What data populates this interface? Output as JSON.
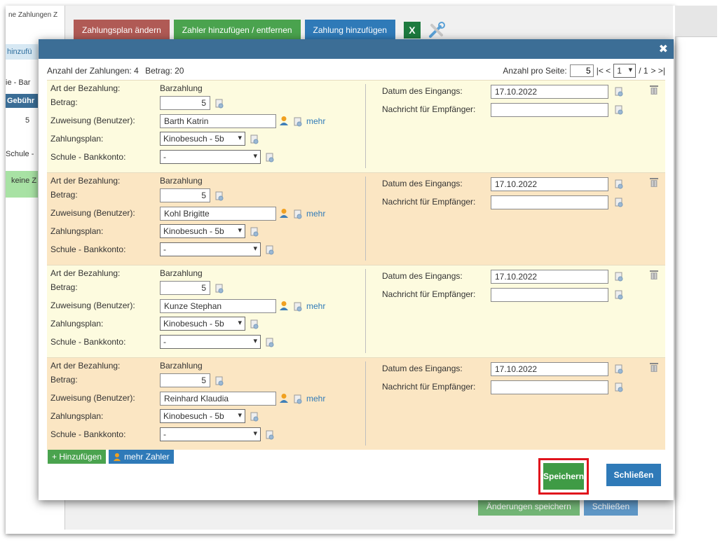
{
  "background": {
    "breadcrumb": "ne Zahlungen   Z",
    "tabs": [
      "Zahlungsplan ändern",
      "Zahler hinzufügen / entfernen",
      "Zahlung hinzufügen"
    ],
    "side_add_button": "hinzufü",
    "side_label_1": "ie - Bar",
    "side_header": "Gebühr",
    "side_value": "5",
    "side_label_2": "Schule -",
    "side_status": "keine Z",
    "bottom_buttons": [
      "Änderungen speichern",
      "Schließen"
    ],
    "colors": {
      "tab_red": "#b05a55",
      "tab_green": "#4aa34e",
      "tab_blue": "#2f7ab8"
    }
  },
  "modal": {
    "close_symbol": "✖",
    "summary": {
      "count_label": "Anzahl der Zahlungen: 4",
      "amount_label": "Betrag: 20"
    },
    "pager": {
      "per_page_label": "Anzahl pro Seite:",
      "per_page": "5",
      "first_prev": "|< <",
      "page": "1",
      "total": "/ 1",
      "next_last": "> >|"
    },
    "labels": {
      "art": "Art der Bezahlung:",
      "betrag": "Betrag:",
      "zuweisung": "Zuweisung (Benutzer):",
      "zahlungsplan": "Zahlungsplan:",
      "bankkonto": "Schule - Bankkonto:",
      "datum": "Datum des Eingangs:",
      "nachricht": "Nachricht für Empfänger:",
      "mehr": "mehr"
    },
    "entries": [
      {
        "art": "Barzahlung",
        "betrag": "5",
        "benutzer": "Barth Katrin",
        "plan": "Kinobesuch - 5b",
        "konto": "-",
        "datum": "17.10.2022",
        "nachricht": ""
      },
      {
        "art": "Barzahlung",
        "betrag": "5",
        "benutzer": "Kohl Brigitte",
        "plan": "Kinobesuch - 5b",
        "konto": "-",
        "datum": "17.10.2022",
        "nachricht": ""
      },
      {
        "art": "Barzahlung",
        "betrag": "5",
        "benutzer": "Kunze Stephan",
        "plan": "Kinobesuch - 5b",
        "konto": "-",
        "datum": "17.10.2022",
        "nachricht": ""
      },
      {
        "art": "Barzahlung",
        "betrag": "5",
        "benutzer": "Reinhard Klaudia",
        "plan": "Kinobesuch - 5b",
        "konto": "-",
        "datum": "17.10.2022",
        "nachricht": ""
      }
    ],
    "add_button": "+ Hinzufügen",
    "more_payers_button": "mehr Zahler",
    "save_button": "Speichern",
    "close_button": "Schließen",
    "colors": {
      "header": "#3c6e96",
      "row_light": "#fdfbdf",
      "row_dark": "#fbe6c3",
      "save": "#3f9b45",
      "highlight": "#e0141c",
      "close": "#2f7ab8"
    }
  }
}
